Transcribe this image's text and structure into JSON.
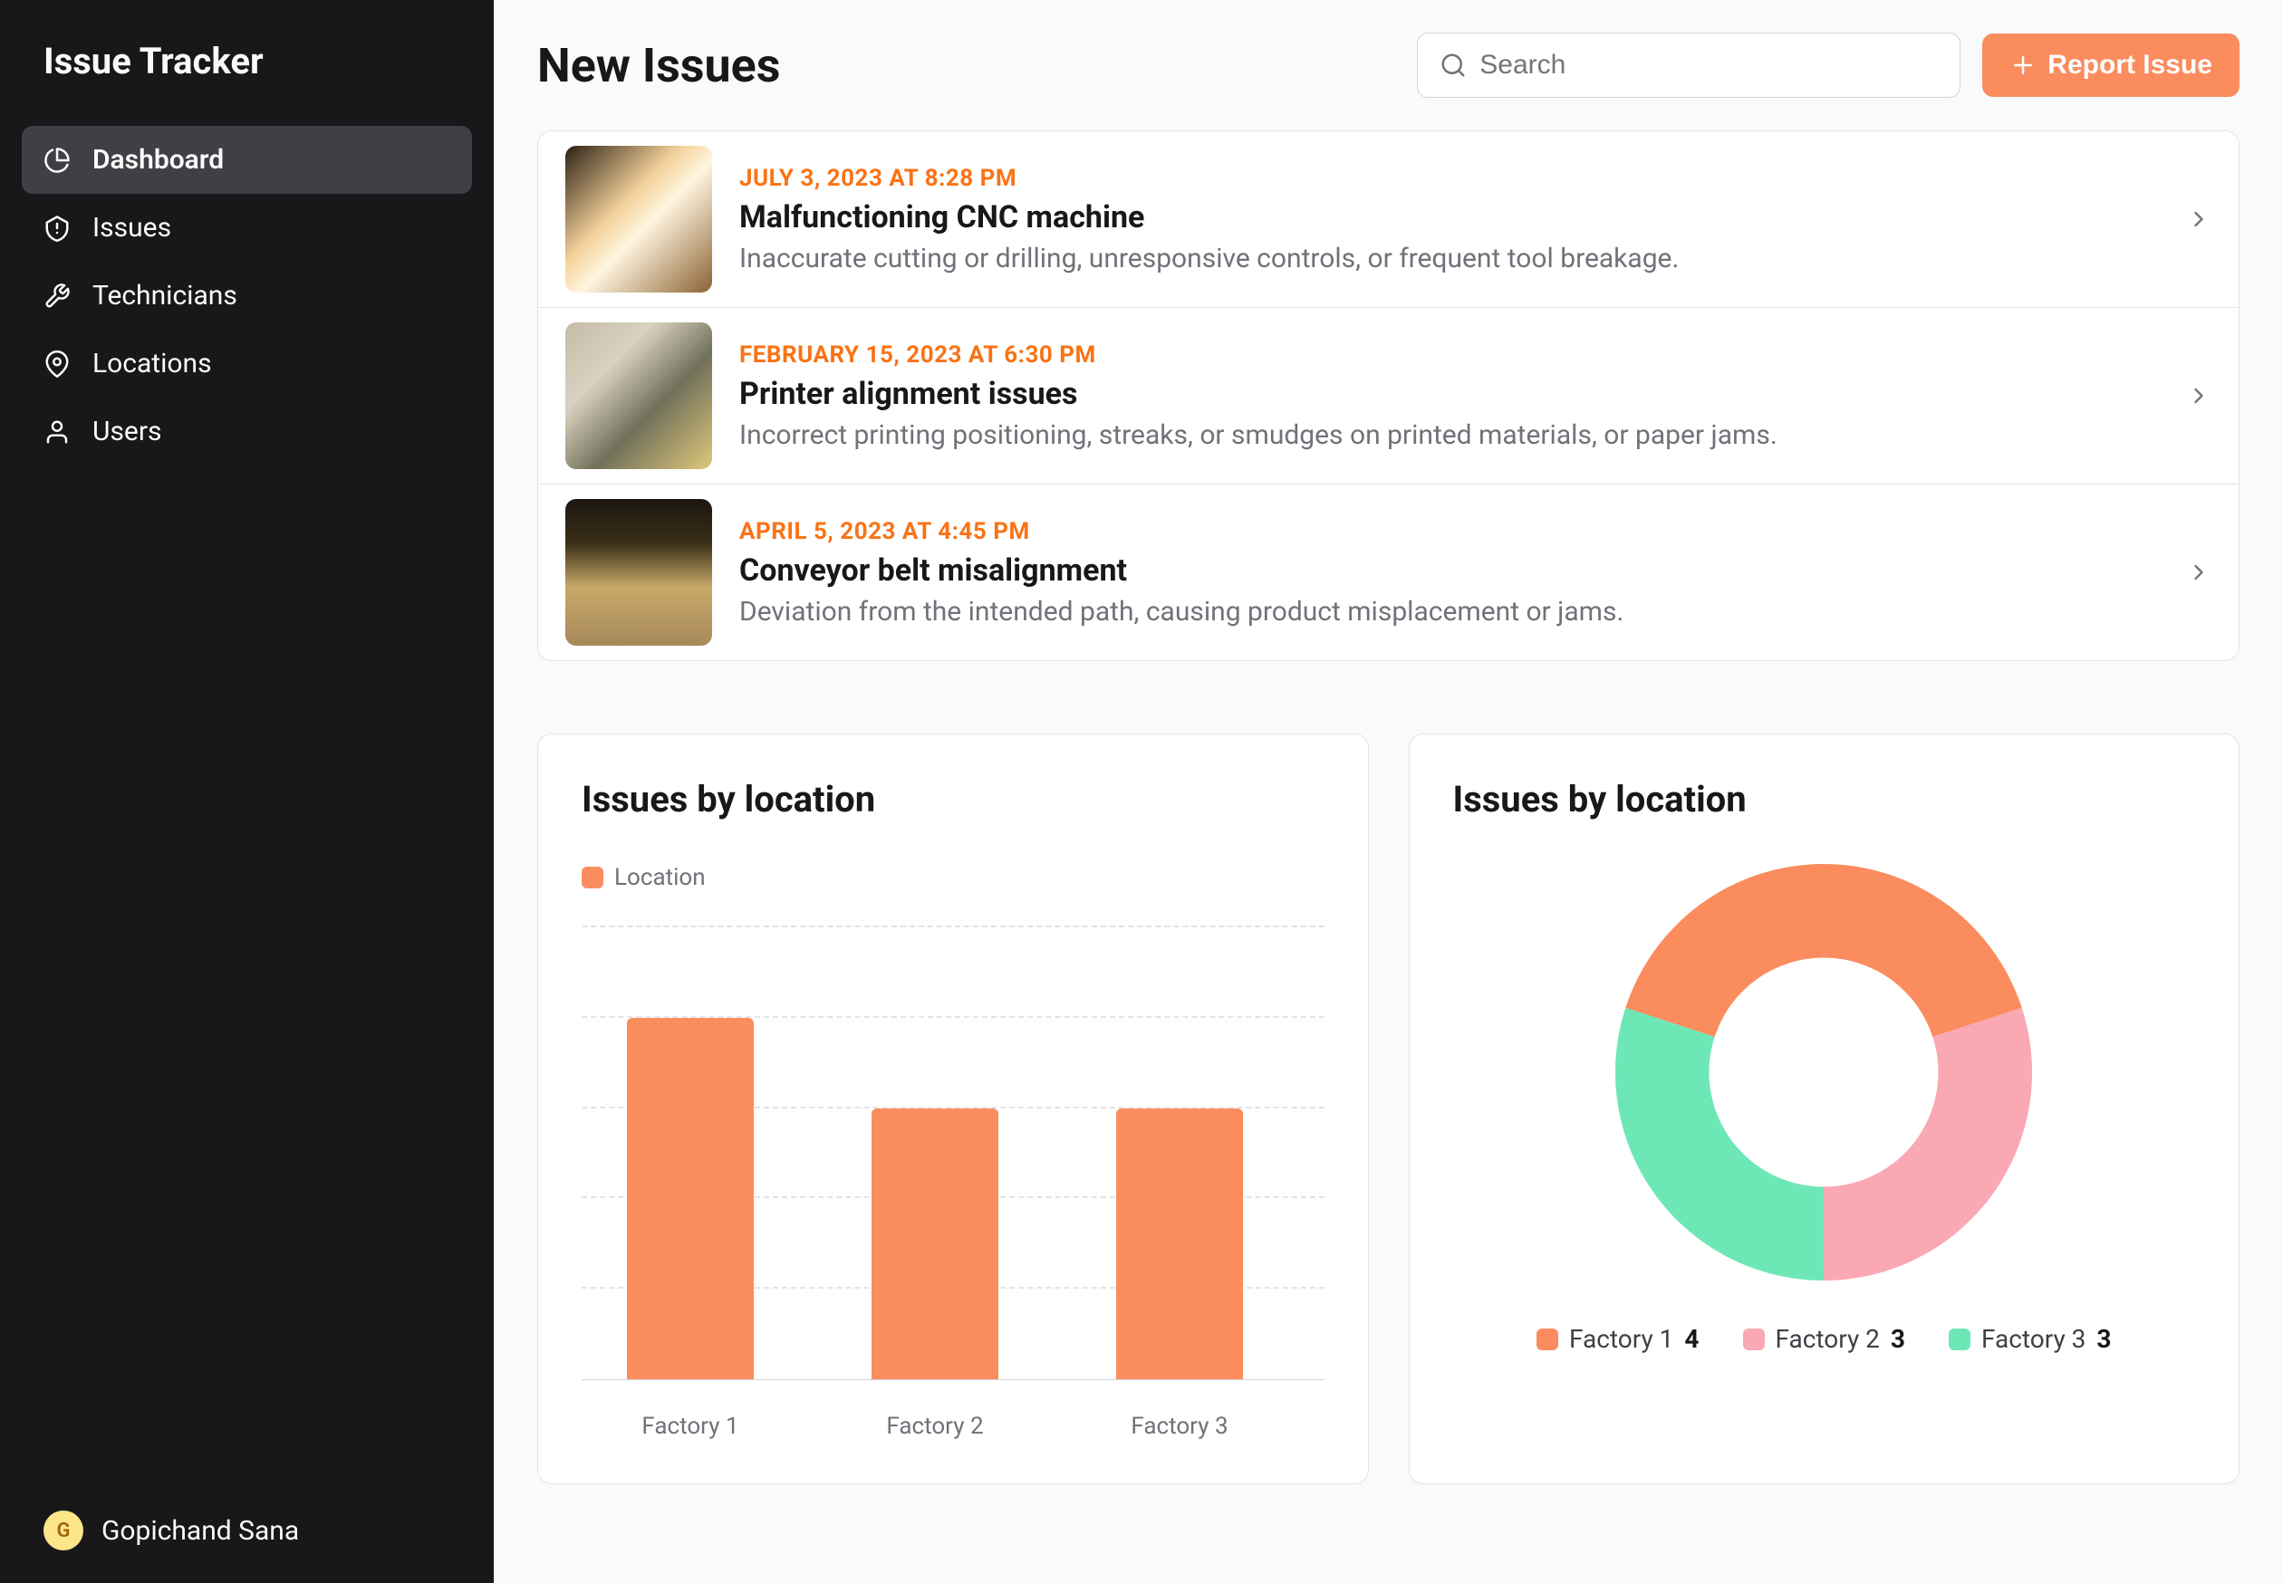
{
  "app_title": "Issue Tracker",
  "sidebar": {
    "items": [
      {
        "label": "Dashboard",
        "active": true
      },
      {
        "label": "Issues",
        "active": false
      },
      {
        "label": "Technicians",
        "active": false
      },
      {
        "label": "Locations",
        "active": false
      },
      {
        "label": "Users",
        "active": false
      }
    ]
  },
  "current_user": {
    "initial": "G",
    "name": "Gopichand Sana"
  },
  "header": {
    "title": "New Issues",
    "search_placeholder": "Search",
    "report_button": "Report Issue"
  },
  "issues": [
    {
      "date": "JULY 3, 2023 AT 8:28 PM",
      "title": "Malfunctioning CNC machine",
      "desc": "Inaccurate cutting or drilling, unresponsive controls, or frequent tool breakage.",
      "thumb_css": "linear-gradient(135deg,#2b2014 0%,#f5d29b 40%,#fff5e0 55%,#8b6233 100%)"
    },
    {
      "date": "FEBRUARY 15, 2023 AT 6:30 PM",
      "title": "Printer alignment issues",
      "desc": "Incorrect printing positioning, streaks, or smudges on printed materials, or paper jams.",
      "thumb_css": "linear-gradient(135deg,#c4bba8 0%,#d9d2c0 30%,#71705a 60%,#dfc87a 100%)"
    },
    {
      "date": "APRIL 5, 2023 AT 4:45 PM",
      "title": "Conveyor belt misalignment",
      "desc": "Deviation from the intended path, causing product misplacement or jams.",
      "thumb_css": "linear-gradient(180deg,#1a1610 0%,#3a2f18 30%,#c7a96a 60%,#a8895a 100%)"
    }
  ],
  "chart_left_title": "Issues by location",
  "chart_left_legend": "Location",
  "chart_right_title": "Issues by location",
  "chart_data": [
    {
      "type": "bar",
      "title": "Issues by location",
      "categories": [
        "Factory 1",
        "Factory 2",
        "Factory 3"
      ],
      "series": [
        {
          "name": "Location",
          "values": [
            4,
            3,
            3
          ]
        }
      ],
      "ylim": [
        0,
        5
      ],
      "color": "#fa8c5e"
    },
    {
      "type": "pie",
      "title": "Issues by location",
      "categories": [
        "Factory 1",
        "Factory 2",
        "Factory 3"
      ],
      "values": [
        4,
        3,
        3
      ],
      "colors": {
        "Factory 1": "#fa8c5e",
        "Factory 2": "#f9a8b4",
        "Factory 3": "#6ee7b7"
      }
    }
  ]
}
